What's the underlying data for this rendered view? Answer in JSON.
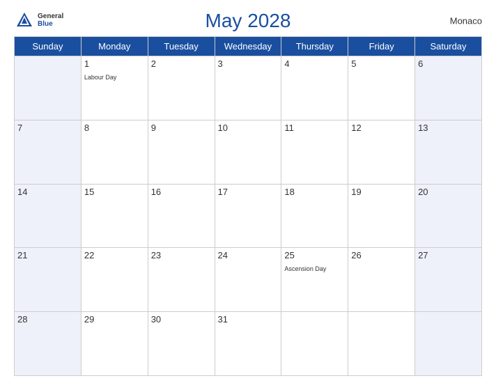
{
  "header": {
    "title": "May 2028",
    "country": "Monaco",
    "logo_general": "General",
    "logo_blue": "Blue"
  },
  "days_of_week": [
    "Sunday",
    "Monday",
    "Tuesday",
    "Wednesday",
    "Thursday",
    "Friday",
    "Saturday"
  ],
  "weeks": [
    [
      {
        "date": "",
        "holiday": ""
      },
      {
        "date": "1",
        "holiday": "Labour Day"
      },
      {
        "date": "2",
        "holiday": ""
      },
      {
        "date": "3",
        "holiday": ""
      },
      {
        "date": "4",
        "holiday": ""
      },
      {
        "date": "5",
        "holiday": ""
      },
      {
        "date": "6",
        "holiday": ""
      }
    ],
    [
      {
        "date": "7",
        "holiday": ""
      },
      {
        "date": "8",
        "holiday": ""
      },
      {
        "date": "9",
        "holiday": ""
      },
      {
        "date": "10",
        "holiday": ""
      },
      {
        "date": "11",
        "holiday": ""
      },
      {
        "date": "12",
        "holiday": ""
      },
      {
        "date": "13",
        "holiday": ""
      }
    ],
    [
      {
        "date": "14",
        "holiday": ""
      },
      {
        "date": "15",
        "holiday": ""
      },
      {
        "date": "16",
        "holiday": ""
      },
      {
        "date": "17",
        "holiday": ""
      },
      {
        "date": "18",
        "holiday": ""
      },
      {
        "date": "19",
        "holiday": ""
      },
      {
        "date": "20",
        "holiday": ""
      }
    ],
    [
      {
        "date": "21",
        "holiday": ""
      },
      {
        "date": "22",
        "holiday": ""
      },
      {
        "date": "23",
        "holiday": ""
      },
      {
        "date": "24",
        "holiday": ""
      },
      {
        "date": "25",
        "holiday": "Ascension Day"
      },
      {
        "date": "26",
        "holiday": ""
      },
      {
        "date": "27",
        "holiday": ""
      }
    ],
    [
      {
        "date": "28",
        "holiday": ""
      },
      {
        "date": "29",
        "holiday": ""
      },
      {
        "date": "30",
        "holiday": ""
      },
      {
        "date": "31",
        "holiday": ""
      },
      {
        "date": "",
        "holiday": ""
      },
      {
        "date": "",
        "holiday": ""
      },
      {
        "date": "",
        "holiday": ""
      }
    ]
  ],
  "colors": {
    "header_bg": "#1a4fa0",
    "weekend_bg": "#eef1f9",
    "text": "#333333",
    "white": "#ffffff"
  }
}
